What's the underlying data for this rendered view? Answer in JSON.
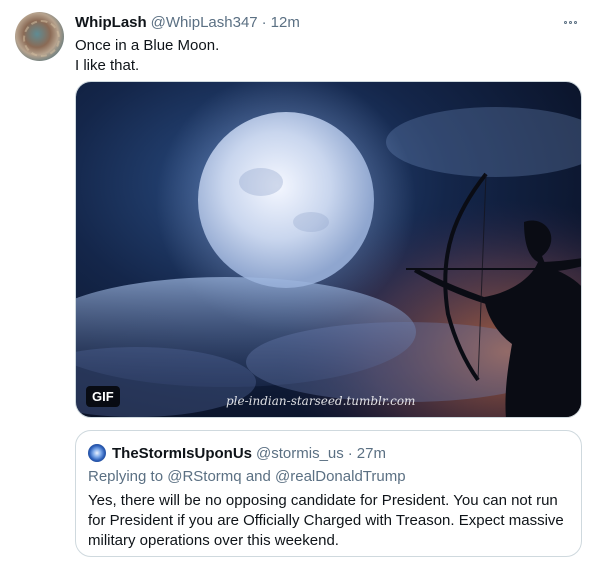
{
  "tweet": {
    "display_name": "WhipLash",
    "handle": "@WhipLash347",
    "separator": "·",
    "time": "12m",
    "text_line1": "Once in a Blue Moon.",
    "text_line2": "I like that.",
    "more_icon": "more-horizontal-icon"
  },
  "media": {
    "badge": "GIF",
    "watermark": "ple-indian-starseed.tumblr.com"
  },
  "quote": {
    "display_name": "TheStormIsUponUs",
    "handle": "@stormis_us",
    "separator": "·",
    "time": "27m",
    "replying_prefix": "Replying to",
    "reply_to_1": "@RStormq",
    "reply_and": "and",
    "reply_to_2": "@realDonaldTrump",
    "text": "Yes, there will be no opposing candidate for President. You can not run for President if you are Officially Charged with Treason. Expect massive military operations over this weekend."
  },
  "colors": {
    "text_primary": "#0f1419",
    "text_secondary": "#5b7083",
    "border": "#cfd9de"
  }
}
